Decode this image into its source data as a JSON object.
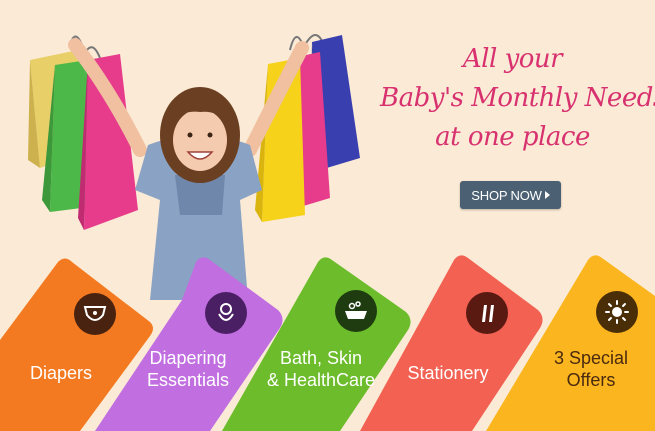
{
  "headline": {
    "line1": "All your",
    "line2": "Baby's Monthly Needs",
    "line3": "at one place"
  },
  "shop_button": {
    "label": "SHOP NOW"
  },
  "categories": [
    {
      "line1": "Diapers",
      "line2": "",
      "color": "#f47a21",
      "icon": "diaper-icon"
    },
    {
      "line1": "Diapering",
      "line2": "Essentials",
      "color": "#c06ee0",
      "icon": "baby-swaddle-icon"
    },
    {
      "line1": "Bath, Skin",
      "line2": "& HealthCare",
      "color": "#6cbc2c",
      "icon": "bathtub-icon"
    },
    {
      "line1": "Stationery",
      "line2": "",
      "color": "#f26152",
      "icon": "pencil-icon"
    },
    {
      "line1": "3 Special",
      "line2": "Offers",
      "color": "#fbb51e",
      "icon": "sun-icon"
    }
  ],
  "colors": {
    "background": "#fbebd6",
    "headline": "#d8316f",
    "button": "#4b6072"
  }
}
